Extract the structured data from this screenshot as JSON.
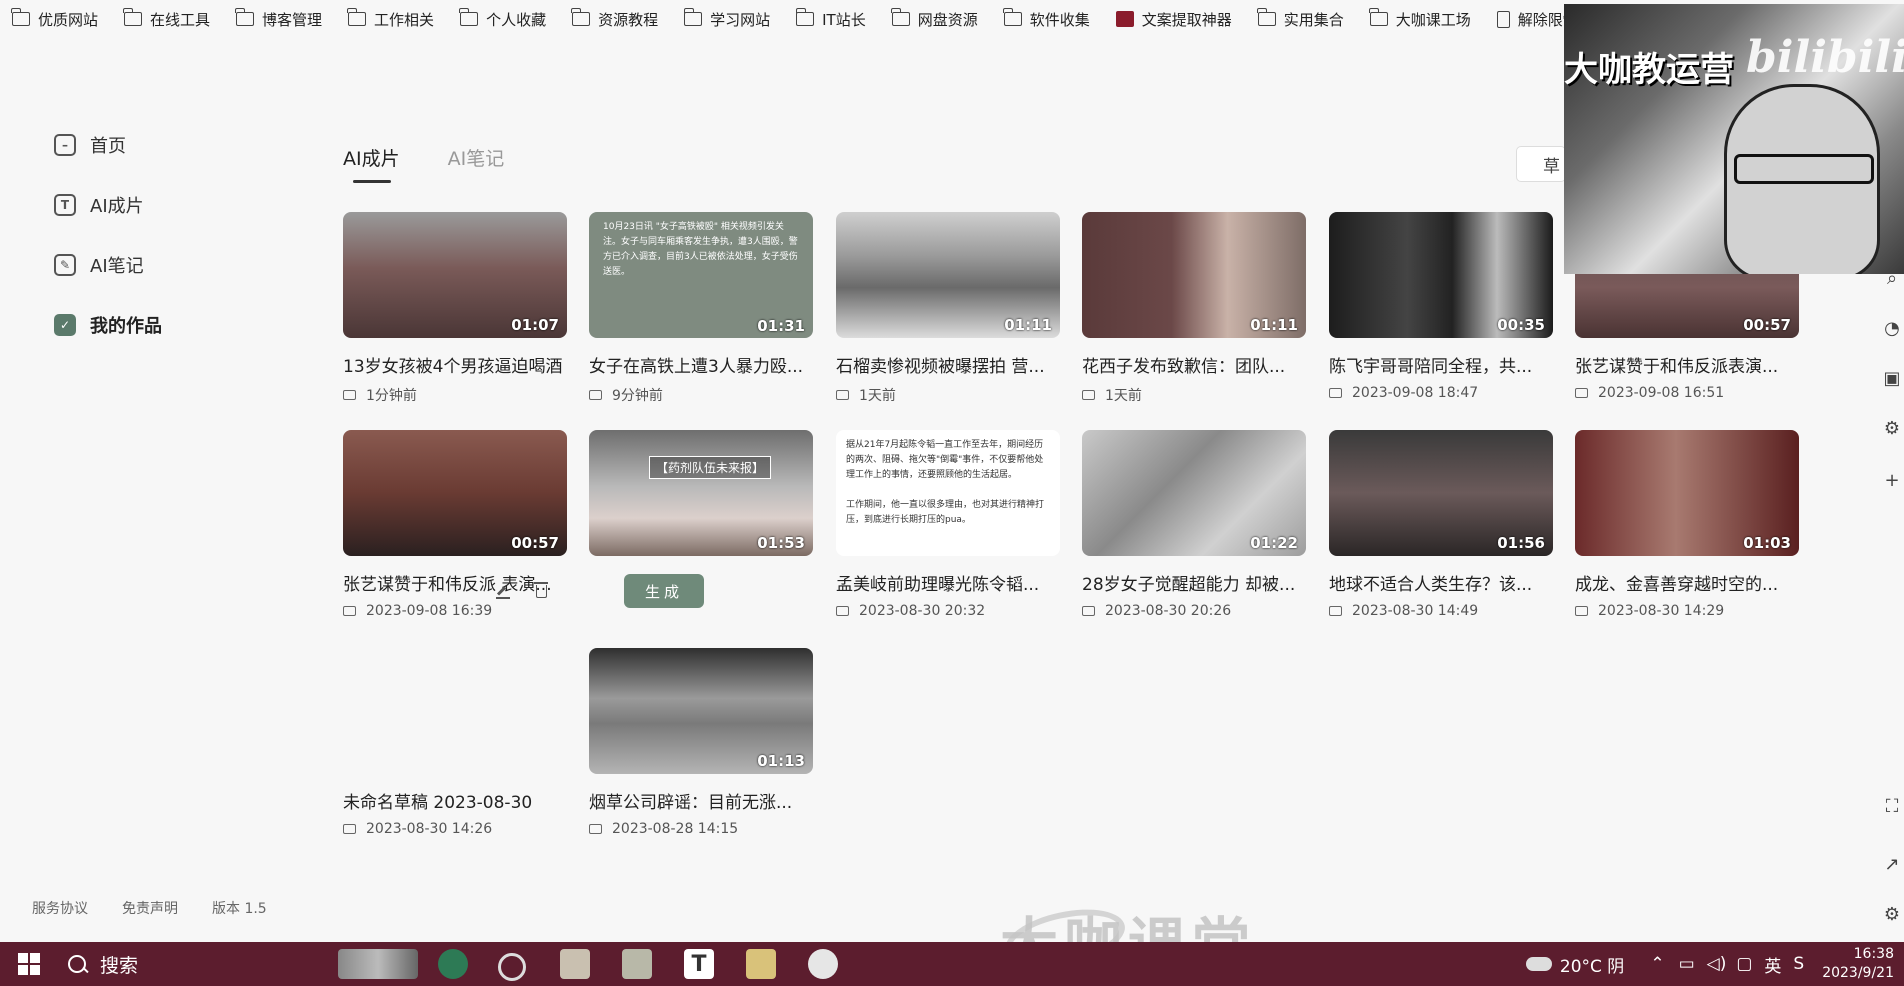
{
  "bookmarks": [
    {
      "label": "优质网站",
      "icon": "folder-icon"
    },
    {
      "label": "在线工具",
      "icon": "folder-icon"
    },
    {
      "label": "博客管理",
      "icon": "folder-icon"
    },
    {
      "label": "工作相关",
      "icon": "folder-icon"
    },
    {
      "label": "个人收藏",
      "icon": "folder-icon"
    },
    {
      "label": "资源教程",
      "icon": "folder-icon"
    },
    {
      "label": "学习网站",
      "icon": "folder-icon"
    },
    {
      "label": "IT站长",
      "icon": "folder-icon"
    },
    {
      "label": "网盘资源",
      "icon": "folder-icon"
    },
    {
      "label": "软件收集",
      "icon": "folder-icon"
    },
    {
      "label": "文案提取神器",
      "icon": "app-icon"
    },
    {
      "label": "实用集合",
      "icon": "folder-icon"
    },
    {
      "label": "大咖课工场",
      "icon": "folder-icon"
    },
    {
      "label": "解除限制",
      "icon": "page-icon"
    }
  ],
  "sidebar": {
    "items": [
      {
        "label": "首页",
        "icon": "home-icon",
        "active": false
      },
      {
        "label": "AI成片",
        "icon": "text-video-icon",
        "active": false
      },
      {
        "label": "AI笔记",
        "icon": "pen-icon",
        "active": false
      },
      {
        "label": "我的作品",
        "icon": "check-icon",
        "active": true
      }
    ],
    "footer": [
      "服务协议",
      "免责声明",
      "版本 1.5"
    ]
  },
  "tabs": [
    {
      "label": "AI成片",
      "active": true
    },
    {
      "label": "AI笔记",
      "active": false
    }
  ],
  "draft_button": "草",
  "cards": [
    {
      "title": "13岁女孩被4个男孩逼迫喝酒",
      "time": "1分钟前",
      "duration": "01:07"
    },
    {
      "title": "女子在高铁上遭3人暴力殴...",
      "time": "9分钟前",
      "duration": "01:31"
    },
    {
      "title": "石榴卖惨视频被曝摆拍 营...",
      "time": "1天前",
      "duration": "01:11"
    },
    {
      "title": "花西子发布致歉信：团队...",
      "time": "1天前",
      "duration": "01:11"
    },
    {
      "title": "陈飞宇哥哥陪同全程，共...",
      "time": "2023-09-08 18:47",
      "duration": "00:35"
    },
    {
      "title": "张艺谋赞于和伟反派表演...",
      "time": "2023-09-08 16:51",
      "duration": "00:57"
    },
    {
      "title": "张艺谋赞于和伟反派 表演...",
      "time": "2023-09-08 16:39",
      "duration": "00:57"
    },
    {
      "title": "",
      "time": "",
      "duration": "01:53",
      "overlay": "【药剂队伍未来报】"
    },
    {
      "title": "孟美岐前助理曝光陈令韬...",
      "time": "2023-08-30 20:32",
      "duration": ""
    },
    {
      "title": "28岁女子觉醒超能力 却被...",
      "time": "2023-08-30 20:26",
      "duration": "01:22"
    },
    {
      "title": "地球不适合人类生存？该...",
      "time": "2023-08-30 14:49",
      "duration": "01:56"
    },
    {
      "title": "成龙、金喜善穿越时空的...",
      "time": "2023-08-30 14:29",
      "duration": "01:03"
    },
    {
      "title": "未命名草稿 2023-08-30",
      "time": "2023-08-30 14:26",
      "duration": ""
    },
    {
      "title": "烟草公司辟谣：目前无涨...",
      "time": "2023-08-28 14:15",
      "duration": "01:13"
    }
  ],
  "card_actions": {
    "generate_label": "生成"
  },
  "thumb_texts": {
    "card2": "10月23日讯 \"女子高铁被殴\" 相关视频引发关注。女子与同车厢乘客发生争执，遭3人围殴，警方已介入调查，目前3人已被依法处理，女子受伤送医。",
    "card9": "据从21年7月起陈令韬一直工作至去年，期间经历的两次、阻碍、拖欠等\"倒霉\"事件，不仅要帮他处理工作上的事情，还要照顾他的生活起居。\n\n工作期间，他一直以很多理由，也对其进行精神打压，到底进行长期打压的pua。"
  },
  "webcam": {
    "title": "大咖教运营",
    "logo": "bilibili"
  },
  "watermark": "大咖课堂",
  "taskbar": {
    "search": "搜索",
    "weather": "20°C 阴",
    "lang": "英",
    "time": "16:38",
    "date": "2023/9/21"
  }
}
